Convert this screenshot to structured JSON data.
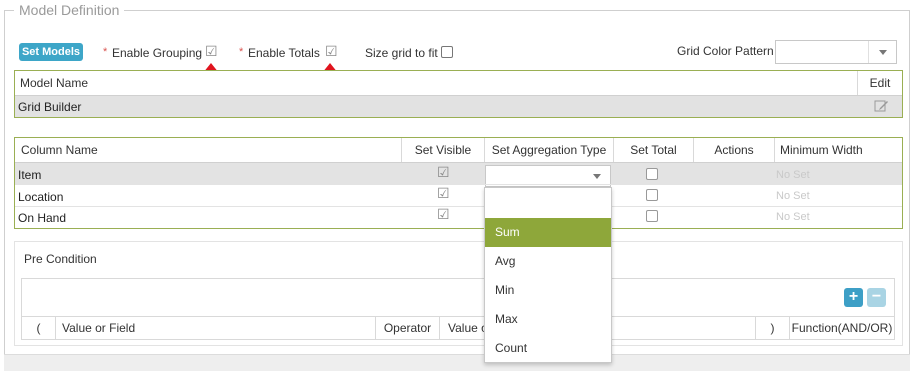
{
  "section": {
    "legend": "Model Definition"
  },
  "toolbar": {
    "set_models_label": "Set Models",
    "required_mark": "*",
    "enable_grouping_label": "Enable Grouping",
    "enable_totals_label": "Enable Totals",
    "size_grid_label": "Size grid to fit",
    "grid_color_pattern_label": "Grid Color Pattern",
    "grid_color_pattern_value": "",
    "enable_grouping_checked": true,
    "enable_totals_checked": true,
    "size_grid_checked": false
  },
  "model_table": {
    "headers": {
      "name": "Model Name",
      "edit": "Edit"
    },
    "rows": [
      {
        "name": "Grid Builder"
      }
    ]
  },
  "columns_table": {
    "headers": {
      "column_name": "Column Name",
      "set_visible": "Set Visible",
      "set_aggregation_type": "Set Aggregation Type",
      "set_total": "Set Total",
      "actions": "Actions",
      "minimum_width": "Minimum Width"
    },
    "rows": [
      {
        "name": "Item",
        "min_width": "No Set"
      },
      {
        "name": "Location",
        "min_width": "No Set"
      },
      {
        "name": "On Hand",
        "min_width": "No Set"
      }
    ]
  },
  "aggregation_dropdown": {
    "options": [
      "",
      "Sum",
      "Avg",
      "Min",
      "Max",
      "Count"
    ],
    "highlighted": "Sum"
  },
  "pre_condition": {
    "title": "Pre Condition",
    "headers": {
      "open_paren": "(",
      "value_or_field": "Value or Field",
      "operator": "Operator",
      "value_partial": "Value o",
      "close_paren": ")",
      "function": "Function(AND/OR)"
    },
    "add_icon": "plus-icon",
    "remove_icon": "minus-icon"
  },
  "colors": {
    "accent_green": "#8ea73a",
    "button_blue": "#3da6c8",
    "arrow_red": "#e0141e",
    "table_border": "#9aaf53"
  }
}
